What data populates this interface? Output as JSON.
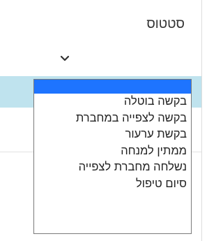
{
  "status_field": {
    "label": "סטטוס",
    "selected_value": "",
    "icon": "chevron-down-icon"
  },
  "dropdown": {
    "highlight_color": "#1e74ff",
    "options": [
      {
        "label": "",
        "highlighted": true
      },
      {
        "label": "בקשה בוטלה"
      },
      {
        "label": "בקשה לצפייה במחברת"
      },
      {
        "label": "בקשת ערעור"
      },
      {
        "label": "ממתין למנחה"
      },
      {
        "label": "נשלחה מחברת לצפייה"
      },
      {
        "label": "סיום טיפול"
      }
    ]
  }
}
